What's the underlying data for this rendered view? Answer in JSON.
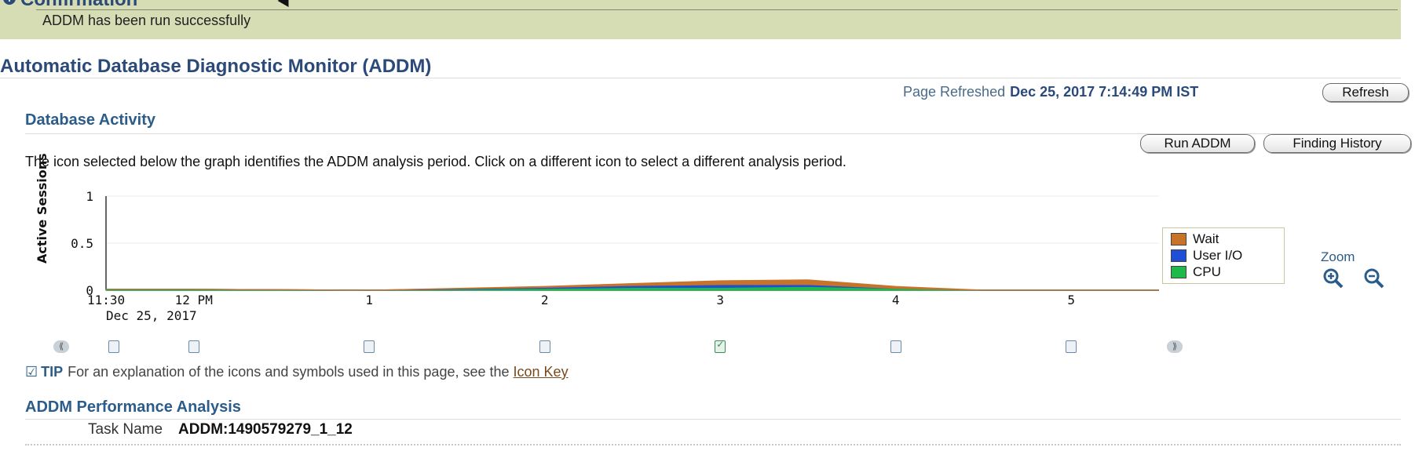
{
  "confirmation": {
    "title": "Confirmation",
    "message": "ADDM has been run successfully"
  },
  "page_title": "Automatic Database Diagnostic Monitor (ADDM)",
  "refresh": {
    "label": "Page Refreshed",
    "timestamp": "Dec 25, 2017 7:14:49 PM IST",
    "button": "Refresh"
  },
  "database_activity": {
    "title": "Database Activity",
    "run_addm_button": "Run ADDM",
    "finding_history_button": "Finding History",
    "instruction": "The icon selected below the graph identifies the ADDM analysis period. Click on a different icon to select a different analysis period."
  },
  "zoom": {
    "label": "Zoom",
    "zoom_in_icon": "zoom-in-icon",
    "zoom_out_icon": "zoom-out-icon"
  },
  "tip": {
    "label": "TIP",
    "text": "For an explanation of the icons and symbols used in this page, see the",
    "link": "Icon Key"
  },
  "performance_analysis": {
    "title": "ADDM Performance Analysis",
    "task_name_label": "Task Name",
    "task_name_value": "ADDM:1490579279_1_12"
  },
  "colors": {
    "wait": "#c8732a",
    "user_io": "#1f4fd6",
    "cpu": "#1fb84a",
    "title": "#2b4a7a",
    "confirmation_bg": "#d6dcb4"
  },
  "chart_data": {
    "type": "area",
    "ylabel": "Active Sessions",
    "ylim": [
      0,
      1
    ],
    "yticks": [
      "0",
      "0.5",
      "1"
    ],
    "xtick_labels": [
      "11:30",
      "12 PM",
      "1",
      "2",
      "3",
      "4",
      "5"
    ],
    "xtick_hours": [
      11.5,
      12,
      13,
      14,
      15,
      16,
      17
    ],
    "x_sublabel": "Dec 25, 2017",
    "xlim": [
      11.5,
      17.5
    ],
    "x": [
      11.5,
      12,
      13,
      14,
      14.5,
      15,
      15.5,
      16,
      16.5,
      17,
      17.5
    ],
    "series": [
      {
        "name": "CPU",
        "color": "#1fb84a",
        "values": [
          0.01,
          0.01,
          0.0,
          0.02,
          0.03,
          0.03,
          0.04,
          0.02,
          0.0,
          0.0,
          0.0
        ]
      },
      {
        "name": "User I/O",
        "color": "#1f4fd6",
        "values": [
          0.0,
          0.0,
          0.0,
          0.01,
          0.02,
          0.03,
          0.02,
          0.0,
          0.0,
          0.0,
          0.0
        ]
      },
      {
        "name": "Wait",
        "color": "#c8732a",
        "values": [
          0.0,
          0.0,
          0.0,
          0.01,
          0.02,
          0.04,
          0.05,
          0.02,
          0.0,
          0.0,
          0.0
        ]
      }
    ],
    "legend_position": "right",
    "analysis_period_icons": [
      "period",
      "period",
      "period",
      "period",
      "selected",
      "period",
      "period"
    ],
    "selected_period": 4
  }
}
